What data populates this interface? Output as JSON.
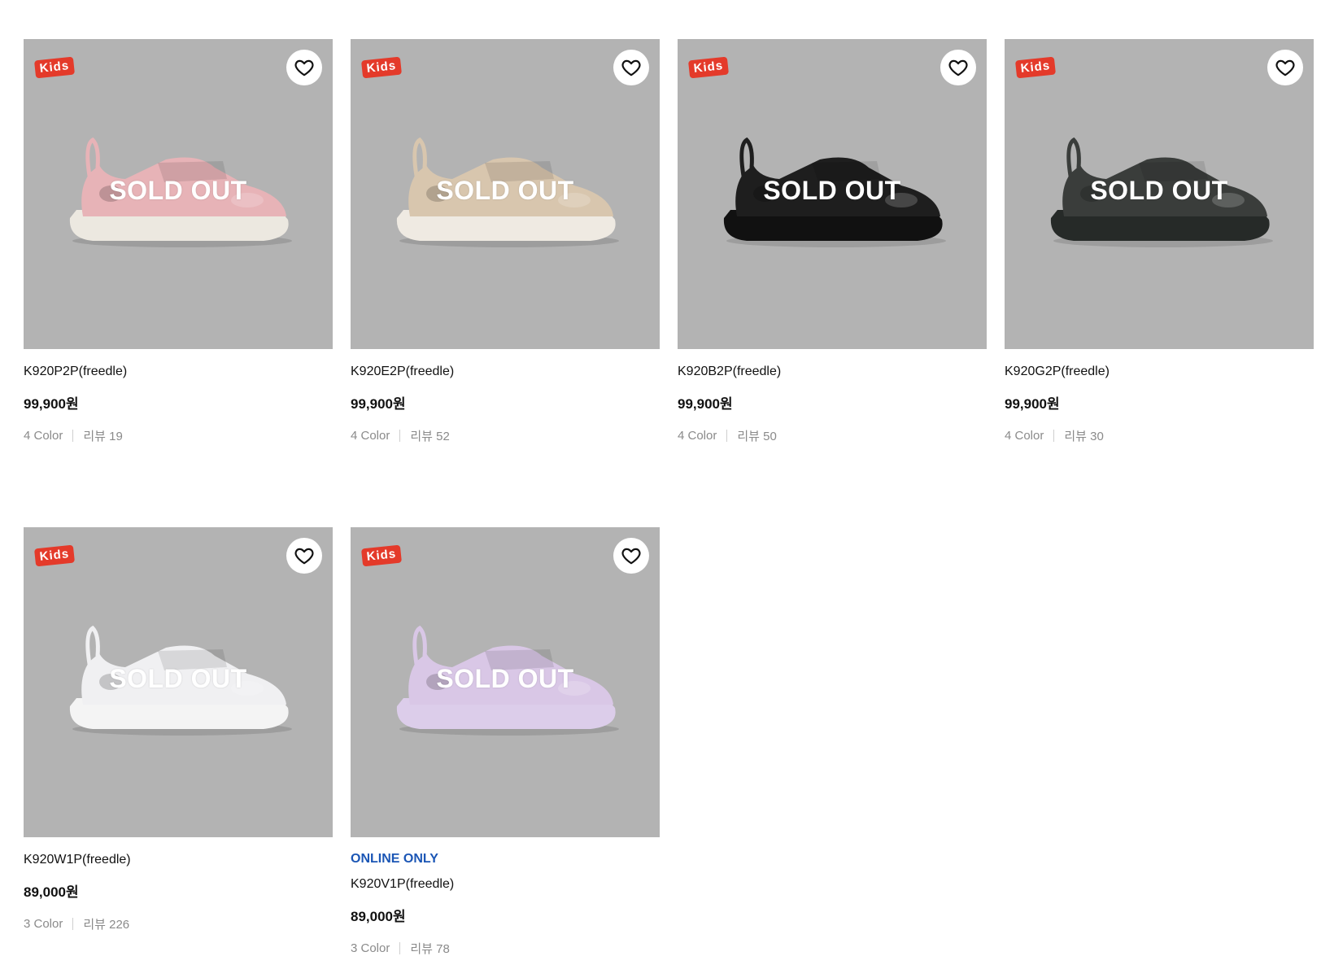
{
  "colors": {
    "thumb_bg": "#b3b3b3",
    "kids_badge": "#e43a2a",
    "online_only": "#1b56b5",
    "meta_text": "#8a8a8a"
  },
  "products": [
    {
      "badge": "Kids",
      "overlay": "SOLD OUT",
      "tag": "",
      "name": "K920P2P(freedle)",
      "price": "99,900원",
      "colors": "4 Color",
      "reviews": "리뷰 19",
      "shoe_color": "#e7b3b7",
      "sole_color": "#ece8e0",
      "icon": "heart-icon"
    },
    {
      "badge": "Kids",
      "overlay": "SOLD OUT",
      "tag": "",
      "name": "K920E2P(freedle)",
      "price": "99,900원",
      "colors": "4 Color",
      "reviews": "리뷰 52",
      "shoe_color": "#d8c6ae",
      "sole_color": "#efeae2",
      "icon": "heart-icon"
    },
    {
      "badge": "Kids",
      "overlay": "SOLD OUT",
      "tag": "",
      "name": "K920B2P(freedle)",
      "price": "99,900원",
      "colors": "4 Color",
      "reviews": "리뷰 50",
      "shoe_color": "#1e1e1e",
      "sole_color": "#111111",
      "icon": "heart-icon"
    },
    {
      "badge": "Kids",
      "overlay": "SOLD OUT",
      "tag": "",
      "name": "K920G2P(freedle)",
      "price": "99,900원",
      "colors": "4 Color",
      "reviews": "리뷰 30",
      "shoe_color": "#3a3d3b",
      "sole_color": "#262a28",
      "icon": "heart-icon"
    },
    {
      "badge": "Kids",
      "overlay": "SOLD OUT",
      "tag": "",
      "name": "K920W1P(freedle)",
      "price": "89,000원",
      "colors": "3 Color",
      "reviews": "리뷰 226",
      "shoe_color": "#f0f0f2",
      "sole_color": "#f4f4f4",
      "icon": "heart-icon"
    },
    {
      "badge": "Kids",
      "overlay": "SOLD OUT",
      "tag": "ONLINE ONLY",
      "name": "K920V1P(freedle)",
      "price": "89,000원",
      "colors": "3 Color",
      "reviews": "리뷰 78",
      "shoe_color": "#d9c7e6",
      "sole_color": "#dccdea",
      "icon": "heart-icon"
    }
  ]
}
